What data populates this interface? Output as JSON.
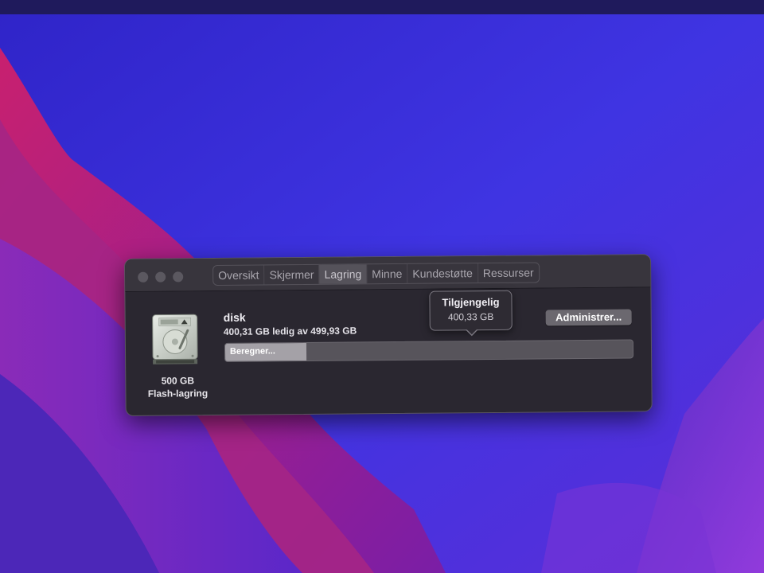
{
  "window": {
    "tabs": [
      {
        "label": "Oversikt"
      },
      {
        "label": "Skjermer"
      },
      {
        "label": "Lagring"
      },
      {
        "label": "Minne"
      },
      {
        "label": "Kundestøtte"
      },
      {
        "label": "Ressurser"
      }
    ],
    "active_tab": "Lagring"
  },
  "storage": {
    "capacity": "500 GB",
    "type": "Flash-lagring",
    "disk_name": "disk",
    "free_text": "400,31 GB ledig av 499,93 GB",
    "bar_label": "Beregner...",
    "used_fraction": 0.2
  },
  "tooltip": {
    "title": "Tilgjengelig",
    "value": "400,33 GB"
  },
  "actions": {
    "manage_label": "Administrer..."
  },
  "icons": {
    "disk": "internal-drive-icon"
  },
  "colors": {
    "wallpaper_blue": "#3b2fd6",
    "wallpaper_magenta": "#b0247e",
    "window_bg": "#2a2730"
  }
}
